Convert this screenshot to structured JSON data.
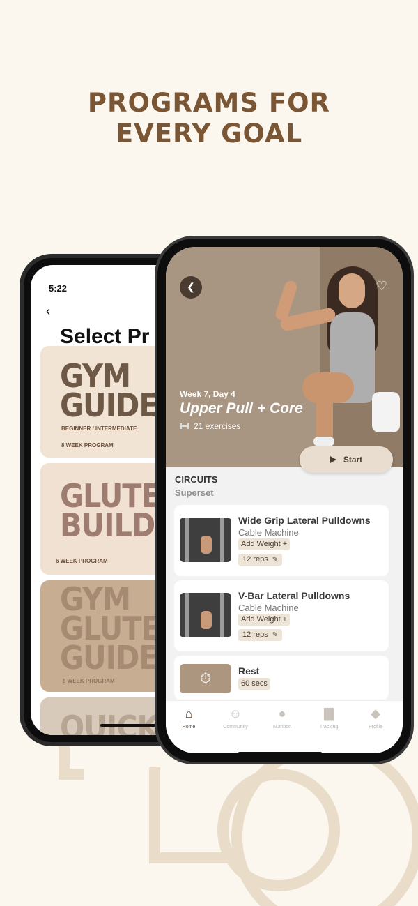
{
  "headline": {
    "line1": "PROGRAMS FOR",
    "line2": "EVERY GOAL"
  },
  "back_phone": {
    "time": "5:22",
    "title": "Select Pr",
    "programs": [
      {
        "title_line1": "GYM",
        "title_line2": "GUIDE",
        "subtitle": "BEGINNER / INTERMEDIATE",
        "weeks": "8 WEEK PROGRAM"
      },
      {
        "title_line1": "GLUTE",
        "title_line2": "BUILDER",
        "subtitle": "",
        "weeks": "6 WEEK PROGRAM"
      },
      {
        "title_line1": "GYM",
        "title_line2": "GLUTE",
        "title_line3": "GUIDE",
        "subtitle": "",
        "weeks": "8 WEEK PROGRAM"
      },
      {
        "title_line1": "QUICK"
      }
    ]
  },
  "workout": {
    "week_day": "Week 7, Day 4",
    "title": "Upper Pull  + Core",
    "exercise_count": "21 exercises",
    "start_label": "Start",
    "section": "CIRCUITS",
    "subsection": "Superset",
    "exercises": [
      {
        "name": "Wide Grip Lateral Pulldowns",
        "equipment": "Cable Machine",
        "add_weight": "Add Weight +",
        "reps": "12 reps"
      },
      {
        "name": "V-Bar Lateral Pulldowns",
        "equipment": "Cable Machine",
        "add_weight": "Add Weight +",
        "reps": "12 reps"
      }
    ],
    "rest": {
      "title": "Rest",
      "duration": "60 secs"
    }
  },
  "tabs": [
    {
      "label": "Home",
      "icon": "home-icon"
    },
    {
      "label": "Community",
      "icon": "community-icon"
    },
    {
      "label": "Nutrition",
      "icon": "apple-icon"
    },
    {
      "label": "Tracking",
      "icon": "bar-chart-icon"
    },
    {
      "label": "Profile",
      "icon": "profile-icon"
    }
  ],
  "colors": {
    "background": "#fbf7ef",
    "headline": "#7a5634",
    "accent": "#ad9680"
  }
}
